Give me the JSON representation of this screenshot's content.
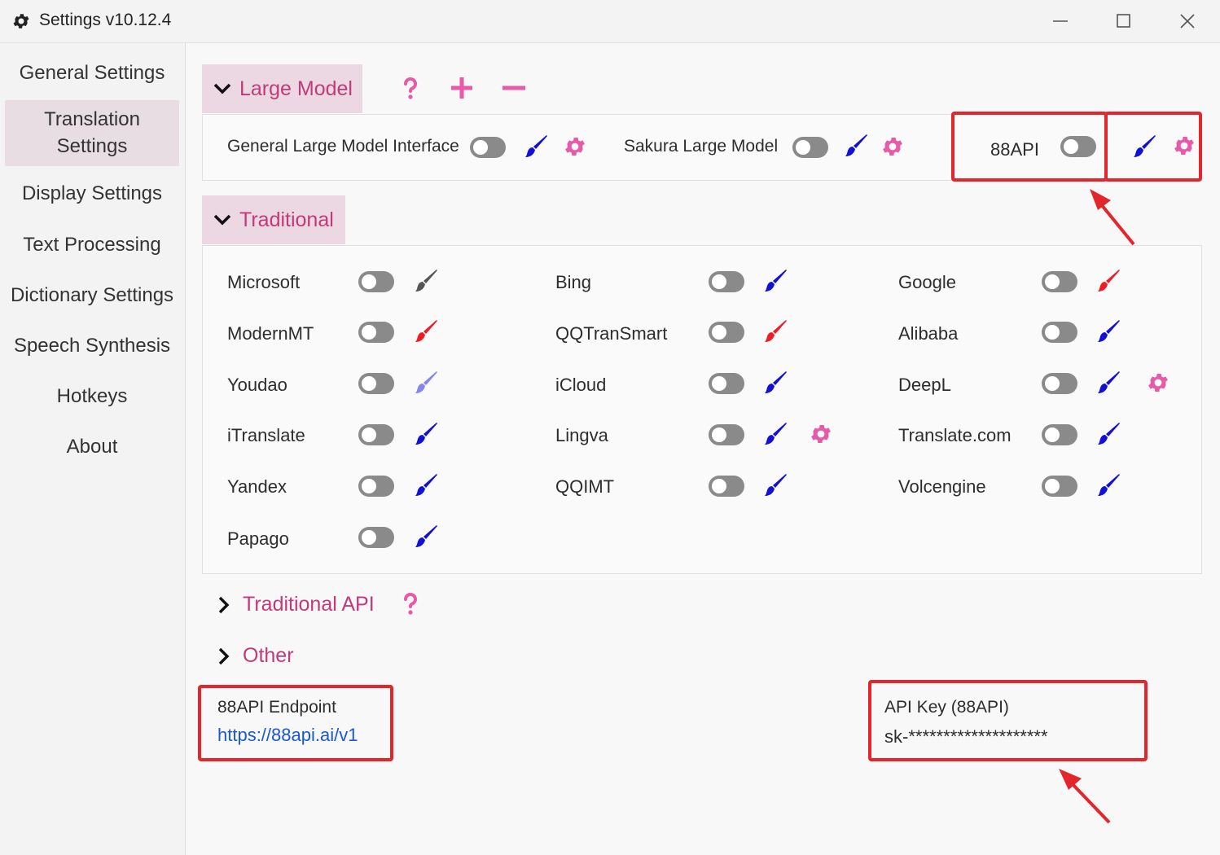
{
  "window": {
    "title": "Settings v10.12.4",
    "icon": "gear-icon",
    "controls": [
      "minimize-icon",
      "maximize-icon",
      "close-icon"
    ]
  },
  "sidebar": {
    "items": [
      {
        "label": "General Settings",
        "active": false
      },
      {
        "label": "Translation\nSettings",
        "active": true
      },
      {
        "label": "Display Settings",
        "active": false
      },
      {
        "label": "Text Processing",
        "active": false
      },
      {
        "label": "Dictionary Settings",
        "active": false
      },
      {
        "label": "Speech Synthesis",
        "active": false
      },
      {
        "label": "Hotkeys",
        "active": false
      },
      {
        "label": "About",
        "active": false
      }
    ]
  },
  "large_model": {
    "title": "Large Model",
    "header_icons": [
      "question-icon",
      "plus-icon",
      "minus-icon"
    ],
    "items": [
      {
        "label": "General Large Model Interface",
        "enabled": false,
        "brush_color": "#1010d8",
        "has_gear": true
      },
      {
        "label": "Sakura Large Model",
        "enabled": false,
        "brush_color": "#1010d8",
        "has_gear": true
      },
      {
        "label": "88API",
        "enabled": false,
        "brush_color": "#1010d8",
        "has_gear": true
      }
    ]
  },
  "traditional": {
    "title": "Traditional",
    "items": [
      {
        "label": "Microsoft",
        "enabled": false,
        "brush_color": "#555555",
        "has_gear": false
      },
      {
        "label": "Bing",
        "enabled": false,
        "brush_color": "#1010d8",
        "has_gear": false
      },
      {
        "label": "Google",
        "enabled": false,
        "brush_color": "#ee1c25",
        "has_gear": false
      },
      {
        "label": "ModernMT",
        "enabled": false,
        "brush_color": "#ee1c25",
        "has_gear": false
      },
      {
        "label": "QQTranSmart",
        "enabled": false,
        "brush_color": "#ee1c25",
        "has_gear": false
      },
      {
        "label": "Alibaba",
        "enabled": false,
        "brush_color": "#1010d8",
        "has_gear": false
      },
      {
        "label": "Youdao",
        "enabled": false,
        "brush_color": "#8585ee",
        "has_gear": false
      },
      {
        "label": "iCloud",
        "enabled": false,
        "brush_color": "#1010d8",
        "has_gear": false
      },
      {
        "label": "DeepL",
        "enabled": false,
        "brush_color": "#1010d8",
        "has_gear": true
      },
      {
        "label": "iTranslate",
        "enabled": false,
        "brush_color": "#1010d8",
        "has_gear": false
      },
      {
        "label": "Lingva",
        "enabled": false,
        "brush_color": "#1010d8",
        "has_gear": true
      },
      {
        "label": "Translate.com",
        "enabled": false,
        "brush_color": "#1010d8",
        "has_gear": false
      },
      {
        "label": "Yandex",
        "enabled": false,
        "brush_color": "#1010d8",
        "has_gear": false
      },
      {
        "label": "QQIMT",
        "enabled": false,
        "brush_color": "#1010d8",
        "has_gear": false
      },
      {
        "label": "Volcengine",
        "enabled": false,
        "brush_color": "#1010d8",
        "has_gear": false
      },
      {
        "label": "Papago",
        "enabled": false,
        "brush_color": "#1010d8",
        "has_gear": false
      }
    ]
  },
  "traditional_api": {
    "title": "Traditional API",
    "icon": "question-icon"
  },
  "other": {
    "title": "Other"
  },
  "endpoint": {
    "label": "88API Endpoint",
    "value": "https://88api.ai/v1"
  },
  "api_key": {
    "label": "API Key (88API)",
    "value": "sk-********************"
  },
  "colors": {
    "accent": "#c23a7b",
    "accent_icon": "#e65aa8",
    "header_bg": "#ecd8e2",
    "highlight_box": "#e3262c",
    "link": "#1a56d6"
  }
}
